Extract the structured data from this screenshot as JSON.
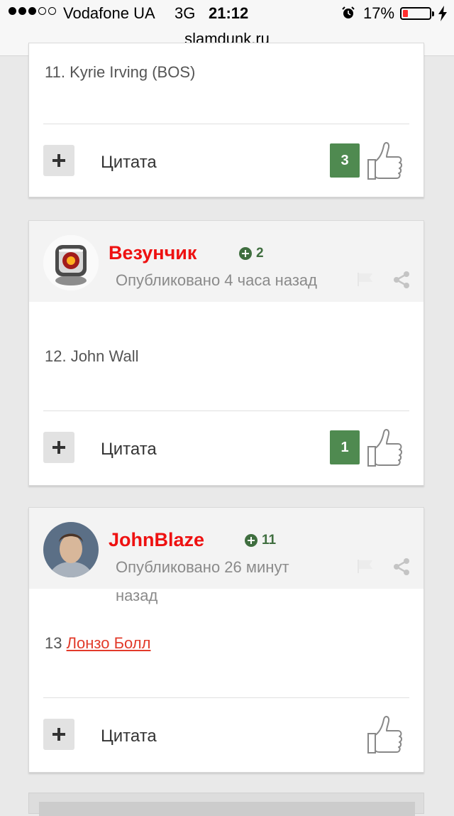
{
  "status_bar": {
    "carrier": "Vodafone UA",
    "network": "3G",
    "time": "21:12",
    "battery": "17%",
    "battery_color": "#ff2d2d",
    "url": "slamdunk.ru"
  },
  "posts": [
    {
      "body": "11. Kyrie Irving (BOS)",
      "quote_label": "Цитата",
      "likes": "3"
    },
    {
      "author": "Везунчик",
      "reputation": "2",
      "published": "Опубликовано 4 часа назад",
      "body": "12. John Wall",
      "quote_label": "Цитата",
      "likes": "1"
    },
    {
      "author": "JohnBlaze",
      "reputation": "11",
      "published": "Опубликовано 26 минут назад",
      "body_prefix": "13 ",
      "body_link": "Лонзо Болл",
      "quote_label": "Цитата"
    }
  ],
  "colors": {
    "author": "#ee1111",
    "reputation": "#3f6e3f",
    "likes_badge": "#4f8a50",
    "link": "#e23a2a"
  }
}
